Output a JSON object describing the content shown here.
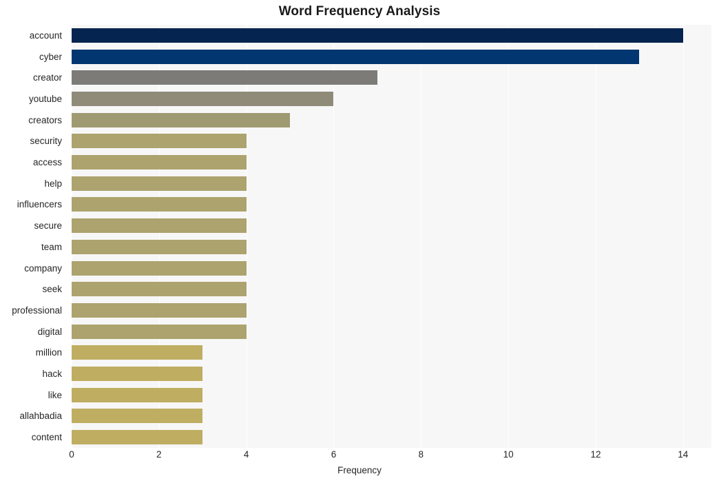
{
  "chart_data": {
    "type": "bar",
    "orientation": "horizontal",
    "title": "Word Frequency Analysis",
    "xlabel": "Frequency",
    "ylabel": "",
    "xlim": [
      0,
      14.65
    ],
    "xticks": [
      0,
      2,
      4,
      6,
      8,
      10,
      12,
      14
    ],
    "xtick_labels": [
      "0",
      "2",
      "4",
      "6",
      "8",
      "10",
      "12",
      "14"
    ],
    "grid": true,
    "grid_axis": "x",
    "legend": null,
    "categories": [
      "account",
      "cyber",
      "creator",
      "youtube",
      "creators",
      "security",
      "access",
      "help",
      "influencers",
      "secure",
      "team",
      "company",
      "seek",
      "professional",
      "digital",
      "million",
      "hack",
      "like",
      "allahbadia",
      "content"
    ],
    "values": [
      14,
      13,
      7,
      6,
      5,
      4,
      4,
      4,
      4,
      4,
      4,
      4,
      4,
      4,
      4,
      3,
      3,
      3,
      3,
      3
    ],
    "bar_colors": [
      "#05244f",
      "#023670",
      "#7c7b78",
      "#908b79",
      "#a09a73",
      "#aca36e",
      "#aca36e",
      "#aca36e",
      "#aca36e",
      "#aca36e",
      "#aca36e",
      "#aca36e",
      "#aca36e",
      "#aca36e",
      "#aca36e",
      "#bfae62",
      "#bfae62",
      "#bfae62",
      "#bfae62",
      "#bfae62"
    ]
  },
  "style": {
    "plot_background": "#f7f7f7",
    "figure_background": "#ffffff",
    "gridline_color": "#ffffff",
    "text_color": "#262626",
    "title_color": "#1a1a1a"
  }
}
